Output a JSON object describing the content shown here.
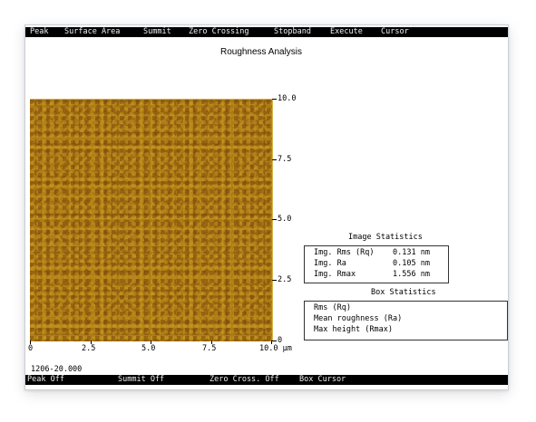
{
  "menu": {
    "items": [
      "Peak",
      "Surface Area",
      "Summit",
      "Zero Crossing",
      "Stopband",
      "Execute",
      "Cursor"
    ]
  },
  "page": {
    "title": "Roughness Analysis"
  },
  "image": {
    "y_ticks": [
      "10.0",
      "7.5",
      "5.0",
      "2.5",
      "0"
    ],
    "x_ticks": [
      "0",
      "2.5",
      "5.0",
      "7.5",
      "10.0 µm"
    ],
    "footer_id": "1206-20.000"
  },
  "image_statistics": {
    "title": "Image Statistics",
    "rows": [
      {
        "label": "Img. Rms (Rq)",
        "value": "0.131 nm"
      },
      {
        "label": "Img. Ra",
        "value": "0.105 nm"
      },
      {
        "label": "Img. Rmax",
        "value": "1.556 nm"
      }
    ]
  },
  "box_statistics": {
    "title": "Box Statistics",
    "rows": [
      "Rms (Rq)",
      "Mean roughness (Ra)",
      "Max height (Rmax)"
    ]
  },
  "status": {
    "items": [
      "Peak Off",
      "Summit Off",
      "Zero Cross. Off",
      "Box Cursor"
    ]
  },
  "colors": {
    "bar_bg": "#000000",
    "bar_text": "#f2f2f2",
    "surface": "#aa7c12"
  }
}
